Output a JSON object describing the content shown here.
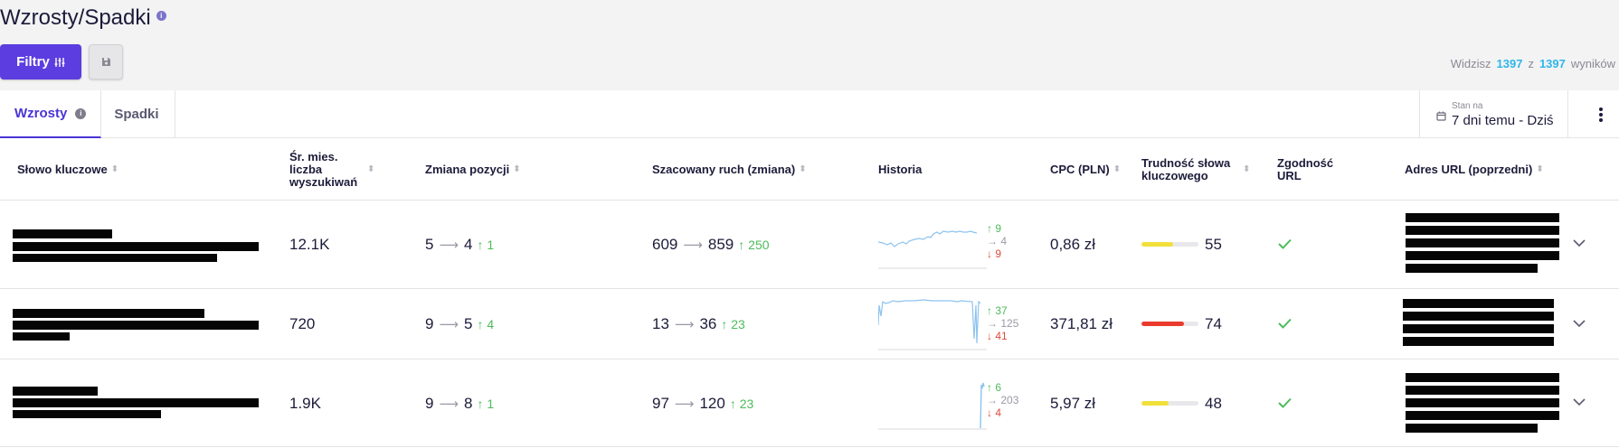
{
  "page": {
    "title": "Wzrosty/Spadki",
    "info_icon": "info-icon"
  },
  "toolbar": {
    "filters_label": "Filtry",
    "filters_icon": "sliders-icon",
    "save_icon": "save-icon"
  },
  "results": {
    "prefix": "Widzisz",
    "shown": "1397",
    "middle": "z",
    "total": "1397",
    "suffix": "wyników"
  },
  "tabs": [
    {
      "label": "Wzrosty",
      "active": true
    },
    {
      "label": "Spadki",
      "active": false
    }
  ],
  "date_filter": {
    "label": "Stan na",
    "value": "7 dni temu - Dziś",
    "icon": "calendar-icon"
  },
  "columns": [
    "Słowo kluczowe",
    "Śr. mies. liczba wyszukiwań",
    "Zmiana pozycji",
    "Szacowany ruch (zmiana)",
    "Historia",
    "CPC (PLN)",
    "Trudność słowa kluczowego",
    "Zgodność URL",
    "Adres URL (poprzedni)"
  ],
  "rows": [
    {
      "volume": "12.1K",
      "pos_from": "5",
      "pos_to": "4",
      "pos_change": "1",
      "traffic_from": "609",
      "traffic_to": "859",
      "traffic_change": "250",
      "hist_up": "9",
      "hist_same": "4",
      "hist_down": "9",
      "cpc": "0,86 zł",
      "difficulty": "55",
      "difficulty_color": "#f2e03a",
      "url_match": true
    },
    {
      "volume": "720",
      "pos_from": "9",
      "pos_to": "5",
      "pos_change": "4",
      "traffic_from": "13",
      "traffic_to": "36",
      "traffic_change": "23",
      "hist_up": "37",
      "hist_same": "125",
      "hist_down": "41",
      "cpc": "371,81 zł",
      "difficulty": "74",
      "difficulty_color": "#ea3a2d",
      "url_match": true
    },
    {
      "volume": "1.9K",
      "pos_from": "9",
      "pos_to": "8",
      "pos_change": "1",
      "traffic_from": "97",
      "traffic_to": "120",
      "traffic_change": "23",
      "hist_up": "6",
      "hist_same": "203",
      "hist_down": "4",
      "cpc": "5,97 zł",
      "difficulty": "48",
      "difficulty_color": "#f2e03a",
      "url_match": true
    }
  ],
  "colors": {
    "accent": "#5b3de0",
    "up": "#4dbb5b",
    "down": "#e04b3c",
    "count": "#2fb6e9",
    "chart_line": "#8ec3ef"
  }
}
